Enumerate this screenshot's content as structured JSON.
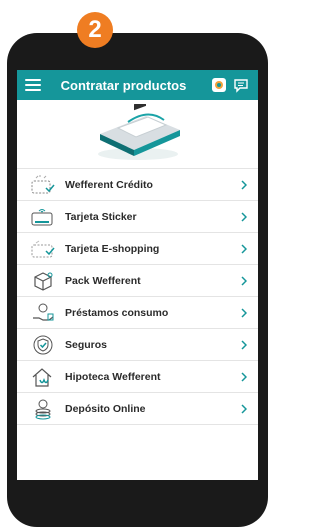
{
  "step": "2",
  "appbar": {
    "title": "Contratar productos"
  },
  "products": [
    {
      "label": "Wefferent Crédito",
      "icon": "card-check-icon"
    },
    {
      "label": "Tarjeta Sticker",
      "icon": "card-sticker-icon"
    },
    {
      "label": "Tarjeta E-shopping",
      "icon": "card-eshopping-icon"
    },
    {
      "label": "Pack Wefferent",
      "icon": "box-icon"
    },
    {
      "label": "Préstamos consumo",
      "icon": "loan-hand-icon"
    },
    {
      "label": "Seguros",
      "icon": "shield-check-icon"
    },
    {
      "label": "Hipoteca Wefferent",
      "icon": "house-icon"
    },
    {
      "label": "Depósito Online",
      "icon": "piggy-coins-icon"
    }
  ],
  "colors": {
    "accent": "#15969a",
    "badge": "#ef7d22",
    "phone": "#1a1a1a"
  }
}
